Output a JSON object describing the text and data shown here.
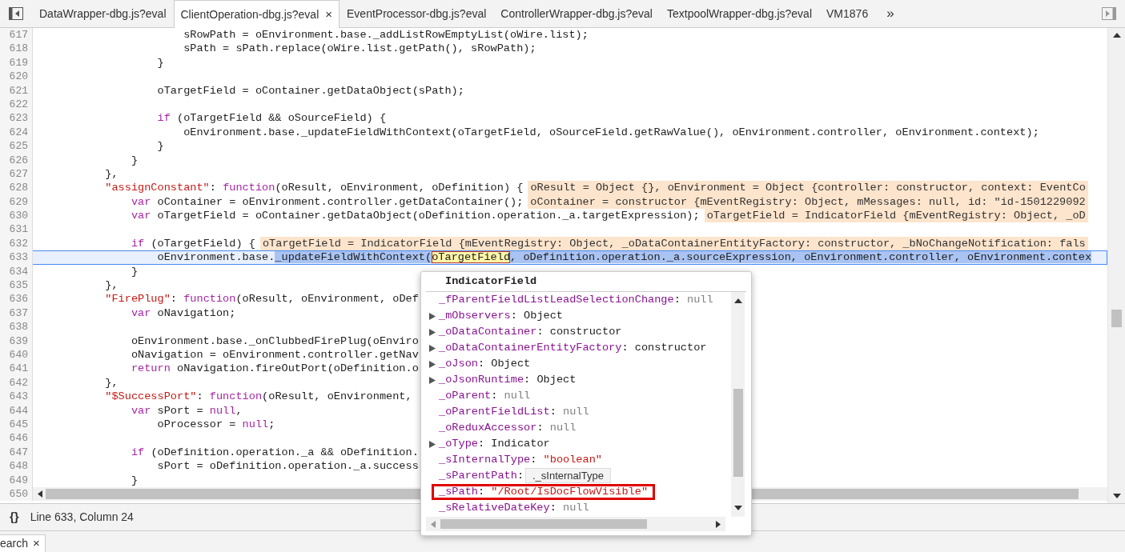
{
  "tabs": [
    {
      "label": "DataWrapper-dbg.js?eval",
      "selected": false,
      "closable": false
    },
    {
      "label": "ClientOperation-dbg.js?eval",
      "selected": true,
      "closable": true
    },
    {
      "label": "EventProcessor-dbg.js?eval",
      "selected": false,
      "closable": false
    },
    {
      "label": "ControllerWrapper-dbg.js?eval",
      "selected": false,
      "closable": false
    },
    {
      "label": "TextpoolWrapper-dbg.js?eval",
      "selected": false,
      "closable": false
    },
    {
      "label": "VM1876",
      "selected": false,
      "closable": false
    }
  ],
  "tabs_overflow": "»",
  "close_glyph": "×",
  "lines": [
    {
      "number": "617",
      "tokens": [
        {
          "kind": "plain",
          "text": "                    sRowPath = oEnvironment.base._addListRowEmptyList(oWire.list);"
        }
      ]
    },
    {
      "number": "618",
      "tokens": [
        {
          "kind": "plain",
          "text": "                    sPath = sPath.replace(oWire.list.getPath(), sRowPath);"
        }
      ]
    },
    {
      "number": "619",
      "tokens": [
        {
          "kind": "plain",
          "text": "                }"
        }
      ]
    },
    {
      "number": "620"
    },
    {
      "number": "621",
      "tokens": [
        {
          "kind": "plain",
          "text": "                oTargetField = oContainer.getDataObject(sPath);"
        }
      ]
    },
    {
      "number": "622"
    },
    {
      "number": "623",
      "tokens": [
        {
          "kind": "keyword",
          "text": "                if"
        },
        {
          "kind": "plain",
          "text": " (oTargetField && oSourceField) {"
        }
      ]
    },
    {
      "number": "624",
      "tokens": [
        {
          "kind": "plain",
          "text": "                    oEnvironment.base._updateFieldWithContext(oTargetField, oSourceField.getRawValue(), oEnvironment.controller, oEnvironment.context);"
        }
      ]
    },
    {
      "number": "625",
      "tokens": [
        {
          "kind": "plain",
          "text": "                }"
        }
      ]
    },
    {
      "number": "626",
      "tokens": [
        {
          "kind": "plain",
          "text": "            }"
        }
      ]
    },
    {
      "number": "627",
      "tokens": [
        {
          "kind": "plain",
          "text": "        },"
        }
      ]
    },
    {
      "number": "628",
      "tokens": [
        {
          "kind": "string",
          "text": "        \"assignConstant\""
        },
        {
          "kind": "plain",
          "text": ": "
        },
        {
          "kind": "keyword",
          "text": "function"
        },
        {
          "kind": "plain",
          "text": "(oResult, oEnvironment, oDefinition) {"
        }
      ],
      "annotation": "oResult = Object {}, oEnvironment = Object {controller: constructor, context: EventCo"
    },
    {
      "number": "629",
      "tokens": [
        {
          "kind": "keyword",
          "text": "            var"
        },
        {
          "kind": "plain",
          "text": " oContainer = oEnvironment.controller.getDataContainer();"
        }
      ],
      "annotation": "oContainer = constructor {mEventRegistry: Object, mMessages: null, id: \"id-1501229092"
    },
    {
      "number": "630",
      "tokens": [
        {
          "kind": "keyword",
          "text": "            var"
        },
        {
          "kind": "plain",
          "text": " oTargetField = oContainer.getDataObject(oDefinition.operation._a.targetExpression);"
        }
      ],
      "annotation": "oTargetField = IndicatorField {mEventRegistry: Object, _oD"
    },
    {
      "number": "631"
    },
    {
      "number": "632",
      "tokens": [
        {
          "kind": "keyword",
          "text": "            if"
        },
        {
          "kind": "plain",
          "text": " (oTargetField) {"
        }
      ],
      "annotation": "oTargetField = IndicatorField {mEventRegistry: Object, _oDataContainerEntityFactory: constructor, _bNoChangeNotification: fals"
    },
    {
      "number": "633",
      "current": true,
      "tokens": [
        {
          "kind": "plain",
          "text": "                oEnvironment.base."
        },
        {
          "kind": "selection",
          "text": "_updateFieldWithContext("
        },
        {
          "kind": "hovered",
          "text": "oTargetField"
        },
        {
          "kind": "selection",
          "text": ", oDefinition.operation._a.sourceExpression, oEnvironment.controller, oEnvironment.contex"
        }
      ]
    },
    {
      "number": "634",
      "tokens": [
        {
          "kind": "plain",
          "text": "            }"
        }
      ]
    },
    {
      "number": "635",
      "tokens": [
        {
          "kind": "plain",
          "text": "        },"
        }
      ]
    },
    {
      "number": "636",
      "tokens": [
        {
          "kind": "string",
          "text": "        \"FirePlug\""
        },
        {
          "kind": "plain",
          "text": ": "
        },
        {
          "kind": "keyword",
          "text": "function"
        },
        {
          "kind": "plain",
          "text": "(oResult, oEnvironment, oDef"
        }
      ]
    },
    {
      "number": "637",
      "tokens": [
        {
          "kind": "keyword",
          "text": "            var"
        },
        {
          "kind": "plain",
          "text": " oNavigation;"
        }
      ]
    },
    {
      "number": "638"
    },
    {
      "number": "639",
      "tokens": [
        {
          "kind": "plain",
          "text": "            oEnvironment.base._onClubbedFirePlug(oEnviro"
        }
      ]
    },
    {
      "number": "640",
      "tokens": [
        {
          "kind": "plain",
          "text": "            oNavigation = oEnvironment.controller.getNav"
        }
      ]
    },
    {
      "number": "641",
      "tokens": [
        {
          "kind": "keyword",
          "text": "            return"
        },
        {
          "kind": "plain",
          "text": " oNavigation.fireOutPort(oDefinition.o"
        }
      ]
    },
    {
      "number": "642",
      "tokens": [
        {
          "kind": "plain",
          "text": "        },"
        }
      ]
    },
    {
      "number": "643",
      "tokens": [
        {
          "kind": "string",
          "text": "        \"$SuccessPort\""
        },
        {
          "kind": "plain",
          "text": ": "
        },
        {
          "kind": "keyword",
          "text": "function"
        },
        {
          "kind": "plain",
          "text": "(oResult, oEnvironment,"
        }
      ]
    },
    {
      "number": "644",
      "tokens": [
        {
          "kind": "keyword",
          "text": "            var"
        },
        {
          "kind": "plain",
          "text": " sPort = "
        },
        {
          "kind": "keyword",
          "text": "null"
        },
        {
          "kind": "plain",
          "text": ","
        }
      ]
    },
    {
      "number": "645",
      "tokens": [
        {
          "kind": "plain",
          "text": "                oProcessor = "
        },
        {
          "kind": "keyword",
          "text": "null"
        },
        {
          "kind": "plain",
          "text": ";"
        }
      ]
    },
    {
      "number": "646"
    },
    {
      "number": "647",
      "tokens": [
        {
          "kind": "keyword",
          "text": "            if"
        },
        {
          "kind": "plain",
          "text": " (oDefinition.operation._a && oDefinition."
        }
      ]
    },
    {
      "number": "648",
      "tokens": [
        {
          "kind": "plain",
          "text": "                sPort = oDefinition.operation._a.success"
        }
      ]
    },
    {
      "number": "649",
      "tokens": [
        {
          "kind": "plain",
          "text": "            }"
        }
      ]
    }
  ],
  "last_line_number": "650",
  "status_bar": {
    "format_button": "{}",
    "position": "Line 633, Column 24"
  },
  "drawer_tab": {
    "label": "earch"
  },
  "popover": {
    "title": "IndicatorField",
    "tooltip": "._sInternalType",
    "separator": ":",
    "properties": [
      {
        "name": "_fParentFieldListLeadSelectionChange",
        "value": "null",
        "kind": "null",
        "expandable": false,
        "marked": false
      },
      {
        "name": "_mObservers",
        "value": "Object",
        "kind": "object",
        "expandable": true,
        "marked": false
      },
      {
        "name": "_oDataContainer",
        "value": "constructor",
        "kind": "object",
        "expandable": true,
        "marked": false
      },
      {
        "name": "_oDataContainerEntityFactory",
        "value": "constructor",
        "kind": "object",
        "expandable": true,
        "marked": false
      },
      {
        "name": "_oJson",
        "value": "Object",
        "kind": "object",
        "expandable": true,
        "marked": false
      },
      {
        "name": "_oJsonRuntime",
        "value": "Object",
        "kind": "object",
        "expandable": true,
        "marked": false
      },
      {
        "name": "_oParent",
        "value": "null",
        "kind": "null",
        "expandable": false,
        "marked": false
      },
      {
        "name": "_oParentFieldList",
        "value": "null",
        "kind": "null",
        "expandable": false,
        "marked": false
      },
      {
        "name": "_oReduxAccessor",
        "value": "null",
        "kind": "null",
        "expandable": false,
        "marked": false
      },
      {
        "name": "_oType",
        "value": "Indicator",
        "kind": "object",
        "expandable": true,
        "marked": false
      },
      {
        "name": "_sInternalType",
        "value": "\"boolean\"",
        "kind": "string",
        "expandable": false,
        "marked": false
      },
      {
        "name": "_sParentPath",
        "expandable": false,
        "marked": false
      },
      {
        "name": "_sPath",
        "value": "\"/Root/IsDocFlowVisible\"",
        "kind": "string",
        "expandable": false,
        "marked": true
      },
      {
        "name": "_sRelativeDateKey",
        "value": "null",
        "kind": "null",
        "expandable": false,
        "marked": false
      }
    ]
  }
}
